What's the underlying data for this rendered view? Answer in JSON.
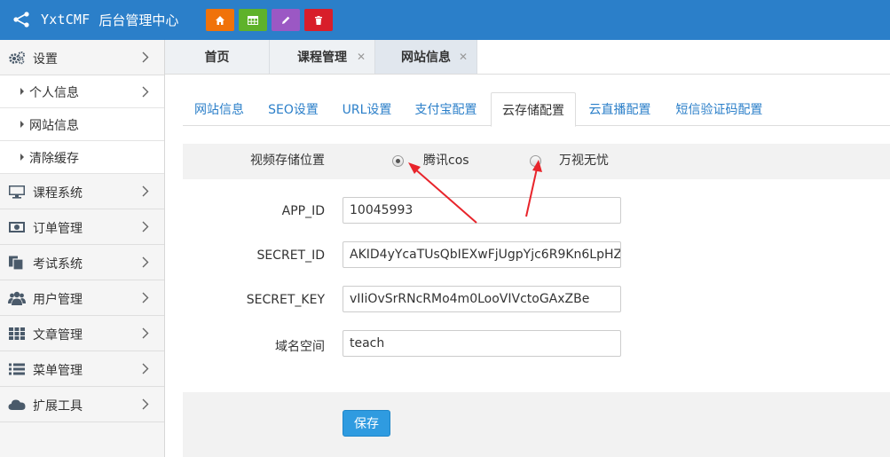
{
  "brand": {
    "name": "YxtCMF",
    "subtitle": "后台管理中心"
  },
  "toolbar": {
    "buttons": [
      {
        "icon": "home-icon",
        "color": "#f0720a"
      },
      {
        "icon": "table-icon",
        "color": "#5fb22a"
      },
      {
        "icon": "pencil-icon",
        "color": "#9b58c4"
      },
      {
        "icon": "trash-icon",
        "color": "#d81e2a"
      }
    ]
  },
  "sidebar": {
    "items": [
      {
        "label": "设置",
        "icon": "gear-icon"
      },
      {
        "label": "课程系统",
        "icon": "monitor-icon"
      },
      {
        "label": "订单管理",
        "icon": "money-icon"
      },
      {
        "label": "考试系统",
        "icon": "copy-icon"
      },
      {
        "label": "用户管理",
        "icon": "users-icon"
      },
      {
        "label": "文章管理",
        "icon": "grid-icon"
      },
      {
        "label": "菜单管理",
        "icon": "list-icon"
      },
      {
        "label": "扩展工具",
        "icon": "cloud-icon"
      }
    ],
    "subitems": [
      {
        "label": "个人信息"
      },
      {
        "label": "网站信息"
      },
      {
        "label": "清除缓存"
      }
    ]
  },
  "page_tabs": [
    {
      "label": "首页",
      "closable": false
    },
    {
      "label": "课程管理",
      "closable": true
    },
    {
      "label": "网站信息",
      "closable": true,
      "active": true
    }
  ],
  "config_tabs": [
    {
      "label": "网站信息"
    },
    {
      "label": "SEO设置"
    },
    {
      "label": "URL设置"
    },
    {
      "label": "支付宝配置"
    },
    {
      "label": "云存储配置",
      "active": true
    },
    {
      "label": "云直播配置"
    },
    {
      "label": "短信验证码配置"
    }
  ],
  "form": {
    "storage_label": "视频存储位置",
    "storage_options": [
      {
        "label": "腾讯cos",
        "checked": true
      },
      {
        "label": "万视无忧",
        "checked": false
      }
    ],
    "app_id": {
      "label": "APP_ID",
      "value": "10045993"
    },
    "secret_id": {
      "label": "SECRET_ID",
      "value": "AKID4yYcaTUsQbIEXwFjUgpYjc6R9Kn6LpHZ"
    },
    "secret_key": {
      "label": "SECRET_KEY",
      "value": "vIIiOvSrRNcRMo4m0LooVIVctoGAxZBe"
    },
    "domain": {
      "label": "域名空间",
      "value": "teach"
    },
    "save_label": "保存"
  },
  "colors": {
    "header": "#2b7fc9",
    "link": "#2b7fc9",
    "save": "#2f9be0",
    "annotation": "#e8242b"
  }
}
